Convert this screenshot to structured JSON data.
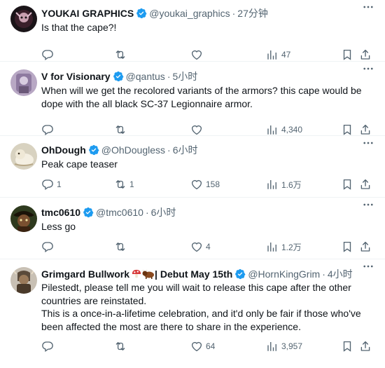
{
  "tweets": [
    {
      "name": "YOUKAI GRAPHICS",
      "handle": "@youkai_graphics",
      "time": "27分钟",
      "text": [
        "Is that the cape?!"
      ],
      "replies": "",
      "retweets": "",
      "likes": "",
      "views": "47"
    },
    {
      "name": "V for Visionary",
      "handle": "@qantus",
      "time": "5小时",
      "text": [
        "When will we get the recolored variants of the armors? this cape would be",
        "dope with the all black SC-37 Legionnaire armor."
      ],
      "replies": "",
      "retweets": "",
      "likes": "",
      "views": "4,340"
    },
    {
      "name": "OhDough",
      "handle": "@OhDougless",
      "time": "6小时",
      "text": [
        "Peak cape teaser"
      ],
      "replies": "1",
      "retweets": "1",
      "likes": "158",
      "views": "1.6万"
    },
    {
      "name": "tmc0610",
      "handle": "@tmc0610",
      "time": "6小时",
      "text": [
        "Less go"
      ],
      "replies": "",
      "retweets": "",
      "likes": "4",
      "views": "1.2万"
    },
    {
      "name": "Grimgard Bullwork",
      "name_suffix": "| Debut May 15th",
      "handle": "@HornKingGrim",
      "time": "4小时",
      "text": [
        "Pilestedt, please tell me you will wait to release this cape after the other",
        "countries are reinstated.",
        "This is a once-in-a-lifetime celebration, and it'd only be fair if those who've",
        "been affected the most are there to share in the experience."
      ],
      "replies": "",
      "retweets": "",
      "likes": "64",
      "views": "3,957"
    }
  ],
  "separator": "·",
  "colors": {
    "verified": "#1d9bf0",
    "muted": "#536471",
    "text": "#0f1419"
  },
  "icons": {
    "reply": "reply-icon",
    "retweet": "retweet-icon",
    "like": "heart-icon",
    "views": "views-icon",
    "bookmark": "bookmark-icon",
    "share": "share-icon",
    "more": "more-icon"
  }
}
